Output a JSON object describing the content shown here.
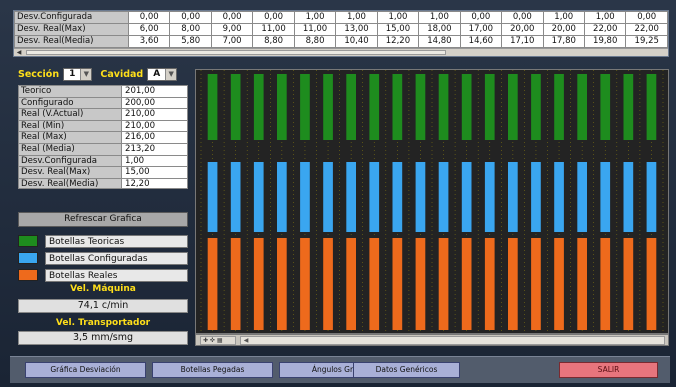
{
  "top_table": {
    "rows": [
      {
        "label": "Desv.Configurada",
        "values": [
          "0,00",
          "0,00",
          "0,00",
          "0,00",
          "1,00",
          "1,00",
          "1,00",
          "1,00",
          "0,00",
          "0,00",
          "1,00",
          "1,00",
          "0,00"
        ]
      },
      {
        "label": "Desv. Real(Max)",
        "values": [
          "6,00",
          "8,00",
          "9,00",
          "11,00",
          "11,00",
          "13,00",
          "15,00",
          "18,00",
          "17,00",
          "20,00",
          "20,00",
          "22,00",
          "22,00"
        ]
      },
      {
        "label": "Desv. Real(Media)",
        "values": [
          "3,60",
          "5,80",
          "7,00",
          "8,80",
          "8,80",
          "10,40",
          "12,20",
          "14,80",
          "14,60",
          "17,10",
          "17,80",
          "19,80",
          "19,25"
        ]
      }
    ]
  },
  "selector": {
    "section_label": "Sección",
    "section_value": "1",
    "cavity_label": "Cavidad",
    "cavity_value": "A"
  },
  "stats": [
    {
      "key": "Teorico",
      "value": "201,00"
    },
    {
      "key": "Configurado",
      "value": "200,00"
    },
    {
      "key": "Real (V.Actual)",
      "value": "210,00"
    },
    {
      "key": "Real (Min)",
      "value": "210,00"
    },
    {
      "key": "Real (Max)",
      "value": "216,00"
    },
    {
      "key": "Real (Media)",
      "value": "213,20"
    },
    {
      "key": "Desv.Configurada",
      "value": "1,00"
    },
    {
      "key": "Desv. Real(Max)",
      "value": "15,00"
    },
    {
      "key": "Desv. Real(Media)",
      "value": "12,20"
    }
  ],
  "refresh_label": "Refrescar Grafica",
  "legend": [
    {
      "label": "Botellas Teoricas",
      "color": "#1e8c1e"
    },
    {
      "label": "Botellas Configuradas",
      "color": "#3aa6f0"
    },
    {
      "label": "Botellas Reales",
      "color": "#ee6a1c"
    }
  ],
  "machine_speed": {
    "label": "Vel. Máquina",
    "value": "74,1 c/min"
  },
  "conveyor_speed": {
    "label": "Vel. Transportador",
    "value": "3,5 mm/smg"
  },
  "chart_data": {
    "type": "bar",
    "description_free": true,
    "bottle_count": 20,
    "bands": [
      {
        "series": "Botellas Teoricas",
        "color": "#1e8c1e"
      },
      {
        "series": "Botellas Configuradas",
        "color": "#3aa6f0"
      },
      {
        "series": "Botellas Reales",
        "color": "#ee6a1c"
      }
    ],
    "background": "#232323",
    "grid": "dotted"
  },
  "nav": {
    "buttons": [
      "Gráfica Desviación",
      "Botellas Pegadas",
      "Ángulos Grupo",
      "Datos Genéricos"
    ],
    "exit": "SALIR"
  }
}
